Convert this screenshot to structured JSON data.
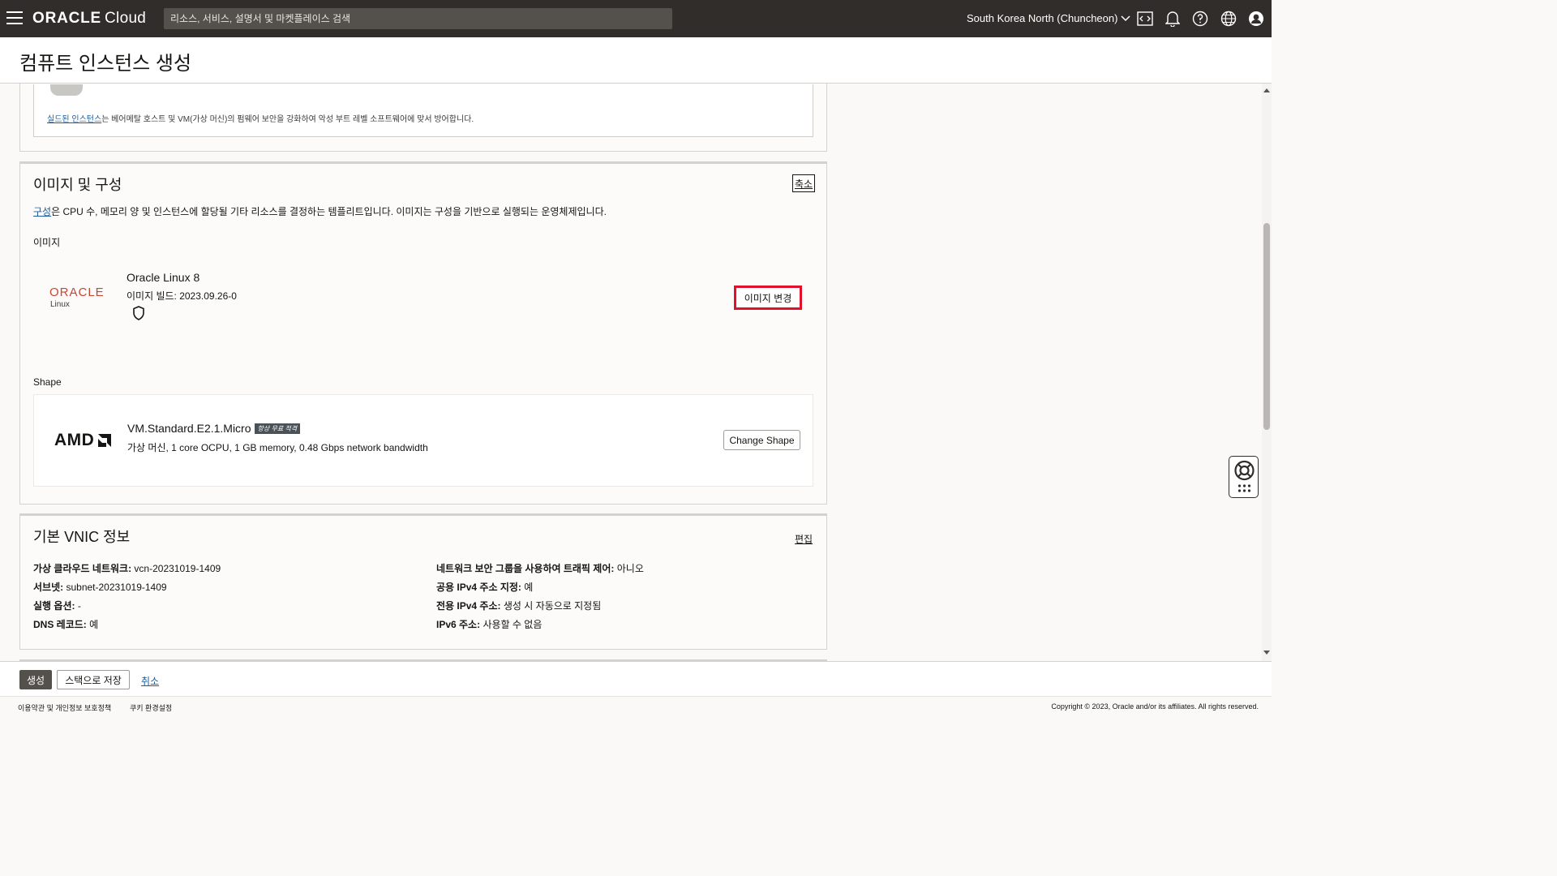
{
  "topbar": {
    "logo_main": "ORACLE",
    "logo_sub": "Cloud",
    "search_placeholder": "리소스, 서비스, 설명서 및 마켓플레이스 검색",
    "region": "South Korea North (Chuncheon)",
    "icons": [
      "code-editor-icon",
      "bell-icon",
      "help-icon",
      "globe-icon",
      "user-icon"
    ]
  },
  "page": {
    "title": "컴퓨트 인스턴스 생성"
  },
  "shielded": {
    "link": "실드된 인스턴스",
    "desc": "는 베어메탈 호스트 및 VM(가상 머신)의 펌웨어 보안을 강화하여 악성 부트 레벨 소프트웨어에 맞서 방어합니다."
  },
  "image_config": {
    "title": "이미지 및 구성",
    "collapse_label": "축소",
    "desc_link": "구성",
    "desc_rest": "은 CPU 수, 메모리 양 및 인스턴스에 할당될 기타 리소스를 결정하는 템플리트입니다. 이미지는 구성을 기반으로 실행되는 운영체제입니다.",
    "image_label": "이미지",
    "image": {
      "logo_main": "ORACLE",
      "logo_sub": "Linux",
      "name": "Oracle Linux 8",
      "build": "이미지 빌드: 2023.09.26-0",
      "change_label": "이미지 변경"
    },
    "shape_label": "Shape",
    "shape": {
      "logo": "AMD",
      "name": "VM.Standard.E2.1.Micro",
      "badge": "항상 무료 적격",
      "desc": "가상 머신, 1 core OCPU, 1 GB memory, 0.48 Gbps network bandwidth",
      "change_label": "Change Shape"
    }
  },
  "vnic": {
    "title": "기본 VNIC 정보",
    "edit_label": "편집",
    "left": [
      {
        "key": "가상 클라우드 네트워크:",
        "value": "vcn-20231019-1409"
      },
      {
        "key": "서브넷:",
        "value": "subnet-20231019-1409"
      },
      {
        "key": "실행 옵션:",
        "value": "-"
      },
      {
        "key": "DNS 레코드:",
        "value": "예"
      }
    ],
    "right": [
      {
        "key": "네트워크 보안 그룹을 사용하여 트래픽 제어:",
        "value": "아니오"
      },
      {
        "key": "공용 IPv4 주소 지정:",
        "value": "예"
      },
      {
        "key": "전용 IPv4 주소:",
        "value": "생성 시 자동으로 지정됨"
      },
      {
        "key": "IPv6 주소:",
        "value": "사용할 수 없음"
      }
    ]
  },
  "actions": {
    "create": "생성",
    "save_stack": "스택으로 저장",
    "cancel": "취소"
  },
  "footer": {
    "terms": "이용약관 및 개인정보 보호정책",
    "cookies": "쿠키 환경설정",
    "copyright": "Copyright © 2023, Oracle and/or its affiliates. All rights reserved."
  },
  "colors": {
    "topbar_bg": "#312d2a",
    "oracle_red": "#c74634",
    "highlight_red": "#e0112b",
    "link_blue": "#1b5c9e"
  }
}
